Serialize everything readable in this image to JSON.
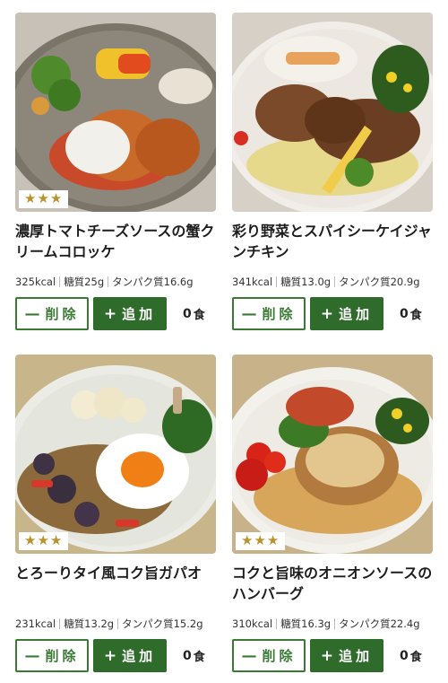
{
  "products": [
    {
      "stars": "★★★",
      "title": "濃厚トマトチーズソースの蟹ク\nリームコロッケ",
      "kcal": "325kcal",
      "carbs": "糖質25g",
      "protein": "タンパク質16.6g",
      "remove_label": "削除",
      "add_label": "追加",
      "count": "0",
      "count_unit": "食"
    },
    {
      "stars": "★★★",
      "title": "彩り野菜とスパイシーケイジャ\nンチキン",
      "kcal": "341kcal",
      "carbs": "糖質13.0g",
      "protein": "タンパク質20.9g",
      "remove_label": "削除",
      "add_label": "追加",
      "count": "0",
      "count_unit": "食"
    },
    {
      "stars": "★★★",
      "title": "とろーりタイ風コク旨ガパオ",
      "kcal": "231kcal",
      "carbs": "糖質13.2g",
      "protein": "タンパク質15.2g",
      "remove_label": "削除",
      "add_label": "追加",
      "count": "0",
      "count_unit": "食"
    },
    {
      "stars": "★★★",
      "title": "コクと旨味のオニオンソースの\nハンバーグ",
      "kcal": "310kcal",
      "carbs": "糖質16.3g",
      "protein": "タンパク質22.4g",
      "remove_label": "削除",
      "add_label": "追加",
      "count": "0",
      "count_unit": "食"
    }
  ],
  "icons": {
    "remove": "minus-icon",
    "add": "plus-icon",
    "rating": "star-icon"
  },
  "colors": {
    "accent_green": "#2f6b2b",
    "star_gold": "#b8932c"
  }
}
